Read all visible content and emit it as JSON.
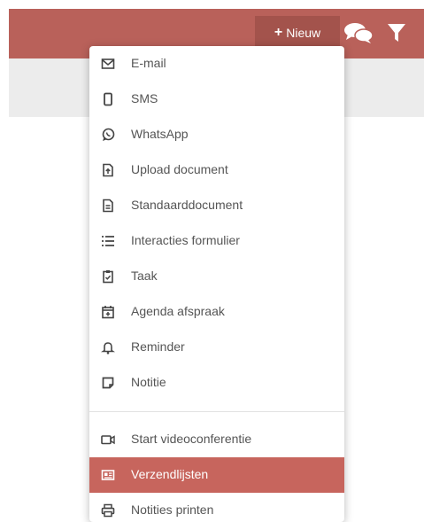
{
  "header": {
    "new_button_label": "Nieuw",
    "new_button_icon": "plus-icon",
    "actions": [
      {
        "icon": "chat-icon"
      },
      {
        "icon": "filter-icon"
      }
    ],
    "colors": {
      "bar": "#b9615a",
      "button": "#a3534c",
      "active_item": "#c7655d"
    }
  },
  "menu": {
    "items": [
      {
        "label": "E-mail",
        "icon": "email-icon"
      },
      {
        "label": "SMS",
        "icon": "phone-icon"
      },
      {
        "label": "WhatsApp",
        "icon": "whatsapp-icon"
      },
      {
        "label": "Upload document",
        "icon": "upload-document-icon"
      },
      {
        "label": "Standaarddocument",
        "icon": "document-icon"
      },
      {
        "label": "Interacties formulier",
        "icon": "list-icon"
      },
      {
        "label": "Taak",
        "icon": "task-clipboard-icon"
      },
      {
        "label": "Agenda afspraak",
        "icon": "calendar-add-icon"
      },
      {
        "label": "Reminder",
        "icon": "bell-icon"
      },
      {
        "label": "Notitie",
        "icon": "note-icon"
      },
      {
        "label": "Start videoconferentie",
        "icon": "video-icon"
      },
      {
        "label": "Verzendlijsten",
        "icon": "mailing-list-icon",
        "active": true
      },
      {
        "label": "Notities printen",
        "icon": "print-icon"
      }
    ]
  }
}
